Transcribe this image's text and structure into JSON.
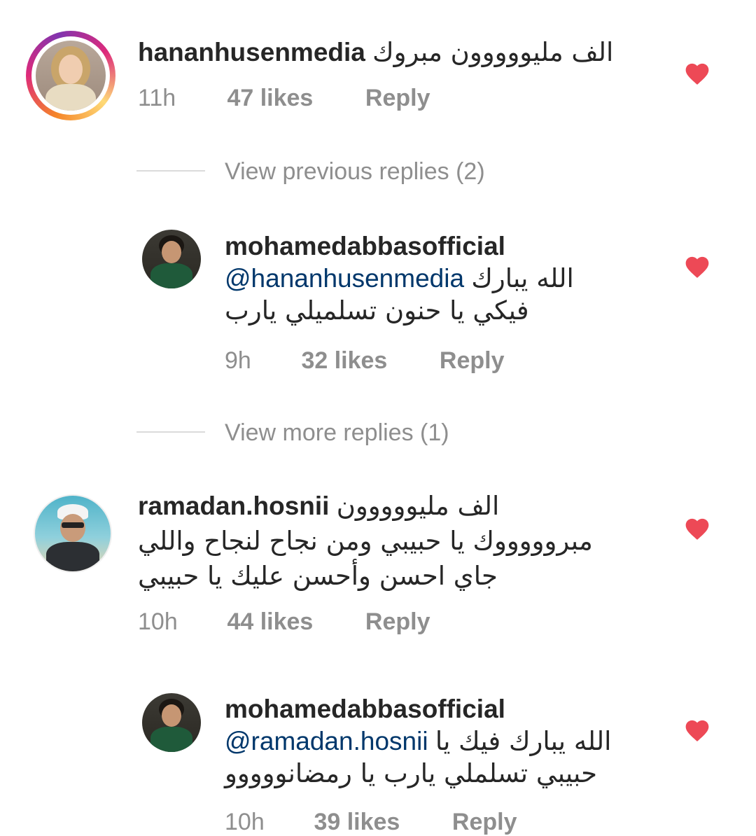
{
  "comments": [
    {
      "username": "hananhusenmedia",
      "text_lines": [
        "الف مليووووون مبروك"
      ],
      "time": "11h",
      "likes": "47 likes",
      "reply": "Reply",
      "liked": true
    },
    {
      "view_replies_label": "View previous replies (2)"
    },
    {
      "username": "mohamedabbasofficial",
      "mention": "@hananhusenmedia",
      "text_after_mention": "الله يبارك",
      "text_lines": [
        "فيكي يا حنون تسلميلي يارب"
      ],
      "time": "9h",
      "likes": "32 likes",
      "reply": "Reply",
      "liked": true
    },
    {
      "view_replies_label": "View more replies (1)"
    },
    {
      "username": "ramadan.hosnii",
      "text_inline": "الف مليووووون",
      "text_lines": [
        "مبروووووك يا حبيبي ومن نجاح لنجاح واللي",
        "جاي احسن وأحسن عليك يا حبيبي"
      ],
      "time": "10h",
      "likes": "44 likes",
      "reply": "Reply",
      "liked": true
    },
    {
      "username": "mohamedabbasofficial",
      "mention": "@ramadan.hosnii",
      "text_after_mention": "الله يبارك فيك يا",
      "text_lines": [
        "حبيبي تسلملي يارب يا رمضانووووو"
      ],
      "time": "10h",
      "likes": "39 likes",
      "reply": "Reply",
      "liked": true
    }
  ],
  "colors": {
    "heart": "#ed4956",
    "meta": "#8e8e8e",
    "mention": "#00376b",
    "divider": "#dbdbdb"
  },
  "icons": {
    "like": "heart-icon"
  }
}
